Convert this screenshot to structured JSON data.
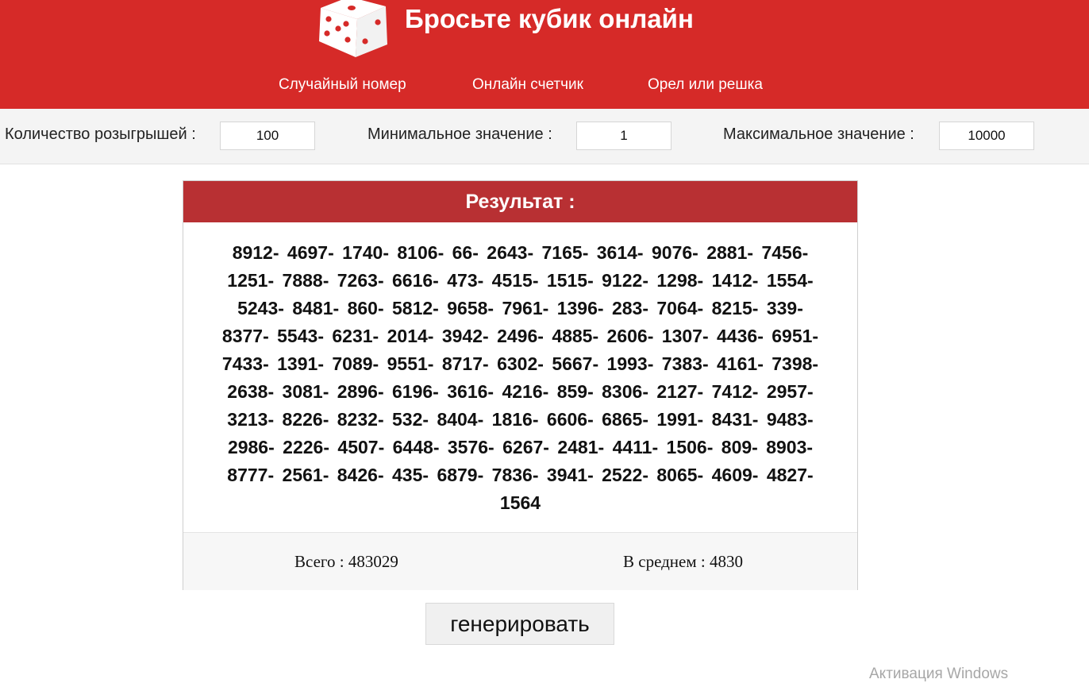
{
  "header": {
    "title": "Бросьте кубик онлайн",
    "brand_color": "#d62a28",
    "logo_icon": "dice-icon",
    "nav": [
      {
        "label": "Случайный номер"
      },
      {
        "label": "Онлайн счетчик"
      },
      {
        "label": "Орел или решка"
      }
    ]
  },
  "settings": {
    "draws_label": "Количество розыгрышей :",
    "draws_value": "100",
    "min_label": "Минимальное значение :",
    "min_value": "1",
    "max_label": "Максимальное значение :",
    "max_value": "10000"
  },
  "result": {
    "title": "Результат :",
    "title_color": "#b83033",
    "numbers": [
      "8912",
      "4697",
      "1740",
      "8106",
      "66",
      "2643",
      "7165",
      "3614",
      "9076",
      "2881",
      "7456",
      "1251",
      "7888",
      "7263",
      "6616",
      "473",
      "4515",
      "1515",
      "9122",
      "1298",
      "1412",
      "1554",
      "5243",
      "8481",
      "860",
      "5812",
      "9658",
      "7961",
      "1396",
      "283",
      "7064",
      "8215",
      "339",
      "8377",
      "5543",
      "6231",
      "2014",
      "3942",
      "2496",
      "4885",
      "2606",
      "1307",
      "4436",
      "6951",
      "7433",
      "1391",
      "7089",
      "9551",
      "8717",
      "6302",
      "5667",
      "1993",
      "7383",
      "4161",
      "7398",
      "2638",
      "3081",
      "2896",
      "6196",
      "3616",
      "4216",
      "859",
      "8306",
      "2127",
      "7412",
      "2957",
      "3213",
      "8226",
      "8232",
      "532",
      "8404",
      "1816",
      "6606",
      "6865",
      "1991",
      "8431",
      "9483",
      "2986",
      "2226",
      "4507",
      "6448",
      "3576",
      "6267",
      "2481",
      "4411",
      "1506",
      "809",
      "8903",
      "8777",
      "2561",
      "8426",
      "435",
      "6879",
      "7836",
      "3941",
      "2522",
      "8065",
      "4609",
      "4827",
      "1564"
    ],
    "total_label": "Всего : 483029",
    "average_label": "В среднем : 4830"
  },
  "actions": {
    "generate_label": "генерировать"
  },
  "watermark": "Активация Windows"
}
